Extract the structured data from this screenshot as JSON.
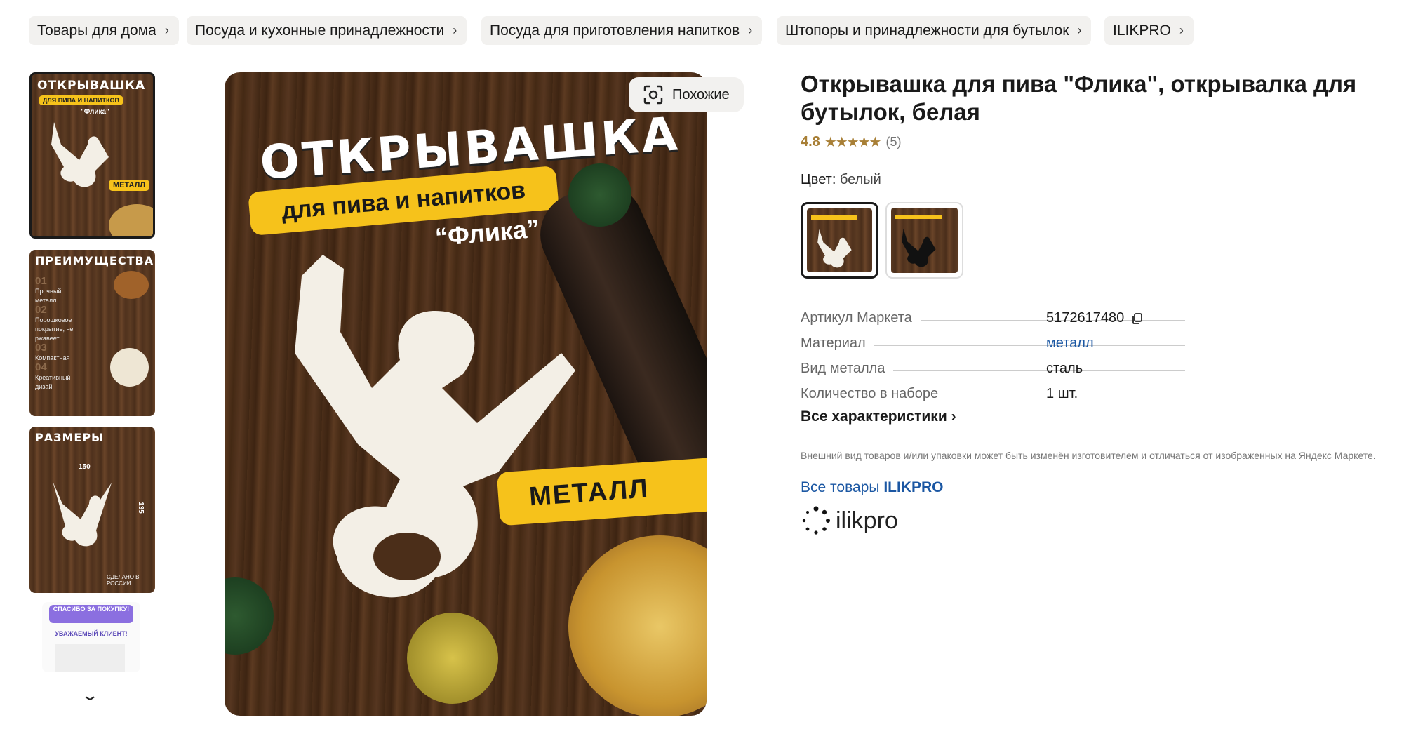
{
  "breadcrumbs": [
    {
      "label": "Товары для дома"
    },
    {
      "label": "Посуда и кухонные принадлежности"
    },
    {
      "label": "Посуда для приготовления напитков"
    },
    {
      "label": "Штопоры и принадлежности для бутылок"
    },
    {
      "label": "ILIKPRO"
    }
  ],
  "gallery": {
    "thumb1": {
      "title": "ОТКРЫВАШКА",
      "ribbon": "ДЛЯ ПИВА И НАПИТКОВ",
      "sub": "\"Флика\"",
      "badge": "МЕТАЛЛ"
    },
    "thumb2": {
      "title": "ПРЕИМУЩЕСТВА",
      "items": [
        {
          "num": "01",
          "text": "Прочный металл"
        },
        {
          "num": "02",
          "text": "Порошковое покрытие, не ржавеет"
        },
        {
          "num": "03",
          "text": "Компактная"
        },
        {
          "num": "04",
          "text": "Креативный дизайн"
        }
      ]
    },
    "thumb3": {
      "title": "РАЗМЕРЫ",
      "width": "150",
      "height": "135",
      "made_in": "СДЕЛАНО В РОССИИ"
    },
    "thumb4": {
      "banner": "СПАСИБО ЗА ПОКУПКУ!",
      "greeting": "УВАЖАЕМЫЙ КЛИЕНТ!"
    },
    "scroll_icon": "chevron-down-icon"
  },
  "main_image": {
    "title": "ОТКРЫВАШКА",
    "ribbon": "для пива и напитков",
    "name": "“Флика”",
    "badge": "МЕТАЛЛ"
  },
  "similar_button": {
    "label": "Похожие",
    "icon": "scan-icon"
  },
  "product": {
    "title": "Открывашка для пива \"Флика\", открывалка для бутылок, белая",
    "rating": "4.8",
    "stars": "★★★★★",
    "reviews": "(5)",
    "color_label": "Цвет:",
    "color_value": "белый"
  },
  "specs": [
    {
      "label": "Артикул Маркета",
      "value": "5172617480"
    },
    {
      "label": "Материал",
      "value": "металл"
    },
    {
      "label": "Вид металла",
      "value": "сталь"
    },
    {
      "label": "Количество в наборе",
      "value": "1 шт."
    }
  ],
  "all_specs": "Все характеристики ›",
  "disclaimer": "Внешний вид товаров и/или упаковки может быть изменён изготовителем и отличаться от изображенных на Яндекс Маркете.",
  "all_goods": {
    "prefix": "Все товары",
    "brand": "ILIKPRO"
  },
  "brand_logo_text": "ilikpro",
  "colors": {
    "accent_yellow": "#f6c21b",
    "link": "#1b57a3",
    "rating": "#a87f36"
  }
}
